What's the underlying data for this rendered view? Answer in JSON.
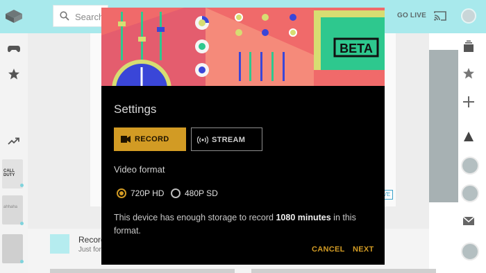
{
  "app": {
    "search_placeholder": "Search",
    "go_live_label": "GO LIVE",
    "bottom_card": {
      "title": "Record",
      "subtitle": "Just for"
    },
    "thumbnail_labels": [
      "CALL DUTY",
      "ahhaha"
    ],
    "live_tag": "VE"
  },
  "dialog": {
    "banner_badge": "BETA",
    "title": "Settings",
    "record_label": "RECORD",
    "stream_label": "STREAM",
    "video_format_label": "Video format",
    "options": [
      "720P HD",
      "480P SD"
    ],
    "selected_option": "720P HD",
    "info_prefix": "This device has enough storage to record ",
    "info_bold": "1080 minutes",
    "info_suffix": " in this format.",
    "cancel_label": "CANCEL",
    "next_label": "NEXT"
  },
  "colors": {
    "accent": "#d29b24",
    "topbar": "#a8e9ec",
    "banner_bg": "#f06a6a",
    "banner_green": "#2ec88e",
    "banner_yellow": "#d7dd72",
    "banner_blue": "#3a46d8"
  }
}
